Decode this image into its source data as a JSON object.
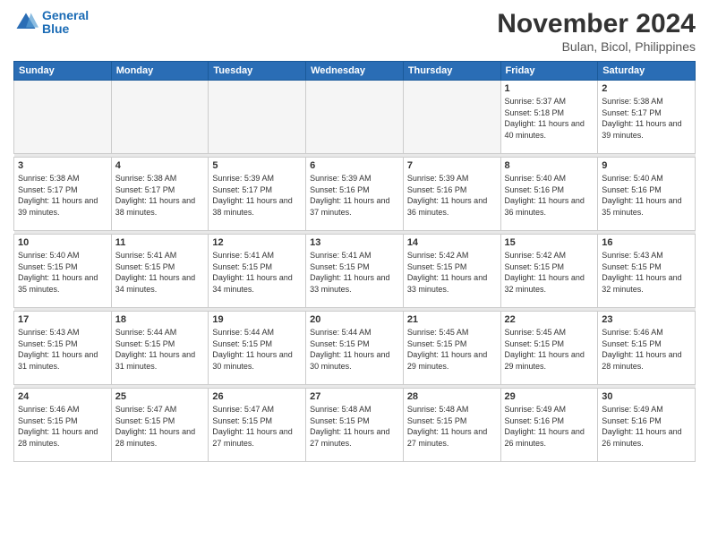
{
  "logo": {
    "line1": "General",
    "line2": "Blue"
  },
  "title": "November 2024",
  "location": "Bulan, Bicol, Philippines",
  "days_of_week": [
    "Sunday",
    "Monday",
    "Tuesday",
    "Wednesday",
    "Thursday",
    "Friday",
    "Saturday"
  ],
  "weeks": [
    [
      {
        "day": "",
        "info": ""
      },
      {
        "day": "",
        "info": ""
      },
      {
        "day": "",
        "info": ""
      },
      {
        "day": "",
        "info": ""
      },
      {
        "day": "",
        "info": ""
      },
      {
        "day": "1",
        "info": "Sunrise: 5:37 AM\nSunset: 5:18 PM\nDaylight: 11 hours and 40 minutes."
      },
      {
        "day": "2",
        "info": "Sunrise: 5:38 AM\nSunset: 5:17 PM\nDaylight: 11 hours and 39 minutes."
      }
    ],
    [
      {
        "day": "3",
        "info": "Sunrise: 5:38 AM\nSunset: 5:17 PM\nDaylight: 11 hours and 39 minutes."
      },
      {
        "day": "4",
        "info": "Sunrise: 5:38 AM\nSunset: 5:17 PM\nDaylight: 11 hours and 38 minutes."
      },
      {
        "day": "5",
        "info": "Sunrise: 5:39 AM\nSunset: 5:17 PM\nDaylight: 11 hours and 38 minutes."
      },
      {
        "day": "6",
        "info": "Sunrise: 5:39 AM\nSunset: 5:16 PM\nDaylight: 11 hours and 37 minutes."
      },
      {
        "day": "7",
        "info": "Sunrise: 5:39 AM\nSunset: 5:16 PM\nDaylight: 11 hours and 36 minutes."
      },
      {
        "day": "8",
        "info": "Sunrise: 5:40 AM\nSunset: 5:16 PM\nDaylight: 11 hours and 36 minutes."
      },
      {
        "day": "9",
        "info": "Sunrise: 5:40 AM\nSunset: 5:16 PM\nDaylight: 11 hours and 35 minutes."
      }
    ],
    [
      {
        "day": "10",
        "info": "Sunrise: 5:40 AM\nSunset: 5:15 PM\nDaylight: 11 hours and 35 minutes."
      },
      {
        "day": "11",
        "info": "Sunrise: 5:41 AM\nSunset: 5:15 PM\nDaylight: 11 hours and 34 minutes."
      },
      {
        "day": "12",
        "info": "Sunrise: 5:41 AM\nSunset: 5:15 PM\nDaylight: 11 hours and 34 minutes."
      },
      {
        "day": "13",
        "info": "Sunrise: 5:41 AM\nSunset: 5:15 PM\nDaylight: 11 hours and 33 minutes."
      },
      {
        "day": "14",
        "info": "Sunrise: 5:42 AM\nSunset: 5:15 PM\nDaylight: 11 hours and 33 minutes."
      },
      {
        "day": "15",
        "info": "Sunrise: 5:42 AM\nSunset: 5:15 PM\nDaylight: 11 hours and 32 minutes."
      },
      {
        "day": "16",
        "info": "Sunrise: 5:43 AM\nSunset: 5:15 PM\nDaylight: 11 hours and 32 minutes."
      }
    ],
    [
      {
        "day": "17",
        "info": "Sunrise: 5:43 AM\nSunset: 5:15 PM\nDaylight: 11 hours and 31 minutes."
      },
      {
        "day": "18",
        "info": "Sunrise: 5:44 AM\nSunset: 5:15 PM\nDaylight: 11 hours and 31 minutes."
      },
      {
        "day": "19",
        "info": "Sunrise: 5:44 AM\nSunset: 5:15 PM\nDaylight: 11 hours and 30 minutes."
      },
      {
        "day": "20",
        "info": "Sunrise: 5:44 AM\nSunset: 5:15 PM\nDaylight: 11 hours and 30 minutes."
      },
      {
        "day": "21",
        "info": "Sunrise: 5:45 AM\nSunset: 5:15 PM\nDaylight: 11 hours and 29 minutes."
      },
      {
        "day": "22",
        "info": "Sunrise: 5:45 AM\nSunset: 5:15 PM\nDaylight: 11 hours and 29 minutes."
      },
      {
        "day": "23",
        "info": "Sunrise: 5:46 AM\nSunset: 5:15 PM\nDaylight: 11 hours and 28 minutes."
      }
    ],
    [
      {
        "day": "24",
        "info": "Sunrise: 5:46 AM\nSunset: 5:15 PM\nDaylight: 11 hours and 28 minutes."
      },
      {
        "day": "25",
        "info": "Sunrise: 5:47 AM\nSunset: 5:15 PM\nDaylight: 11 hours and 28 minutes."
      },
      {
        "day": "26",
        "info": "Sunrise: 5:47 AM\nSunset: 5:15 PM\nDaylight: 11 hours and 27 minutes."
      },
      {
        "day": "27",
        "info": "Sunrise: 5:48 AM\nSunset: 5:15 PM\nDaylight: 11 hours and 27 minutes."
      },
      {
        "day": "28",
        "info": "Sunrise: 5:48 AM\nSunset: 5:15 PM\nDaylight: 11 hours and 27 minutes."
      },
      {
        "day": "29",
        "info": "Sunrise: 5:49 AM\nSunset: 5:16 PM\nDaylight: 11 hours and 26 minutes."
      },
      {
        "day": "30",
        "info": "Sunrise: 5:49 AM\nSunset: 5:16 PM\nDaylight: 11 hours and 26 minutes."
      }
    ]
  ]
}
